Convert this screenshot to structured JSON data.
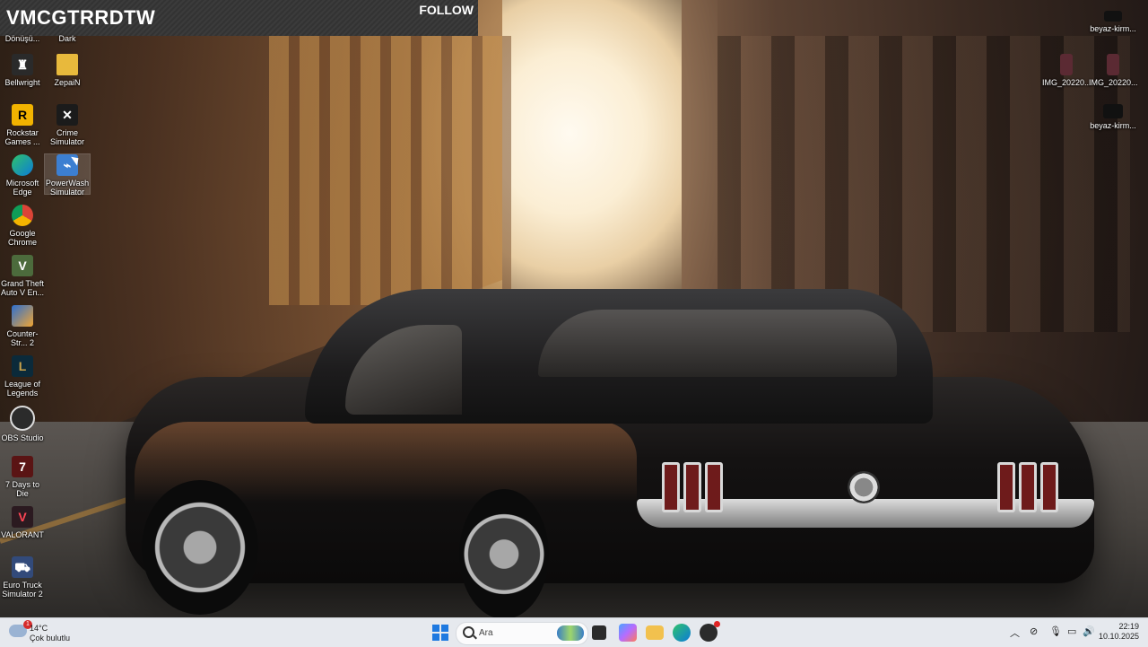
{
  "banner": {
    "title": "VMCGTRRDTW",
    "follow_label": "FOLLOW"
  },
  "desktop": {
    "icons_left": [
      {
        "label": "Dönüşü...",
        "icon": "app-icon"
      },
      {
        "label": "Dark",
        "icon": "app-icon"
      },
      {
        "label": "Bellwright",
        "icon": "bellwright-icon"
      },
      {
        "label": "ZepaiN",
        "icon": "folder-icon"
      },
      {
        "label": "Rockstar Games ...",
        "icon": "rockstar-icon"
      },
      {
        "label": "Crime Simulator",
        "icon": "crime-simulator-icon"
      },
      {
        "label": "Microsoft Edge",
        "icon": "edge-icon"
      },
      {
        "label": "PowerWash Simulator",
        "icon": "powerwash-icon"
      },
      {
        "label": "Google Chrome",
        "icon": "chrome-icon"
      },
      {
        "label": "Grand Theft Auto V En...",
        "icon": "gta-icon"
      },
      {
        "label": "Counter-Str... 2",
        "icon": "counter-strike-icon"
      },
      {
        "label": "League of Legends",
        "icon": "lol-icon"
      },
      {
        "label": "OBS Studio",
        "icon": "obs-icon"
      },
      {
        "label": "7 Days to Die",
        "icon": "7dtd-icon"
      },
      {
        "label": "VALORANT",
        "icon": "valorant-icon"
      },
      {
        "label": "Euro Truck Simulator 2",
        "icon": "ets2-icon"
      }
    ],
    "icons_right": [
      {
        "label": "beyaz-kirm...",
        "icon": "image-icon"
      },
      {
        "label": "IMG_20220...",
        "icon": "image-icon"
      },
      {
        "label": "IMG_20220...",
        "icon": "image-icon"
      },
      {
        "label": "beyaz-kirm...",
        "icon": "image-icon"
      }
    ]
  },
  "taskbar": {
    "weather_temp": "14°C",
    "weather_desc": "Çok bulutlu",
    "weather_badge": "1",
    "search_placeholder": "Ara",
    "clock_time": "22:19",
    "clock_date": "10.10.2025"
  },
  "colors": {
    "taskbar_bg": "#e6e9ee",
    "start_blue": "#1e79e0",
    "banner_bg": "#383838"
  }
}
